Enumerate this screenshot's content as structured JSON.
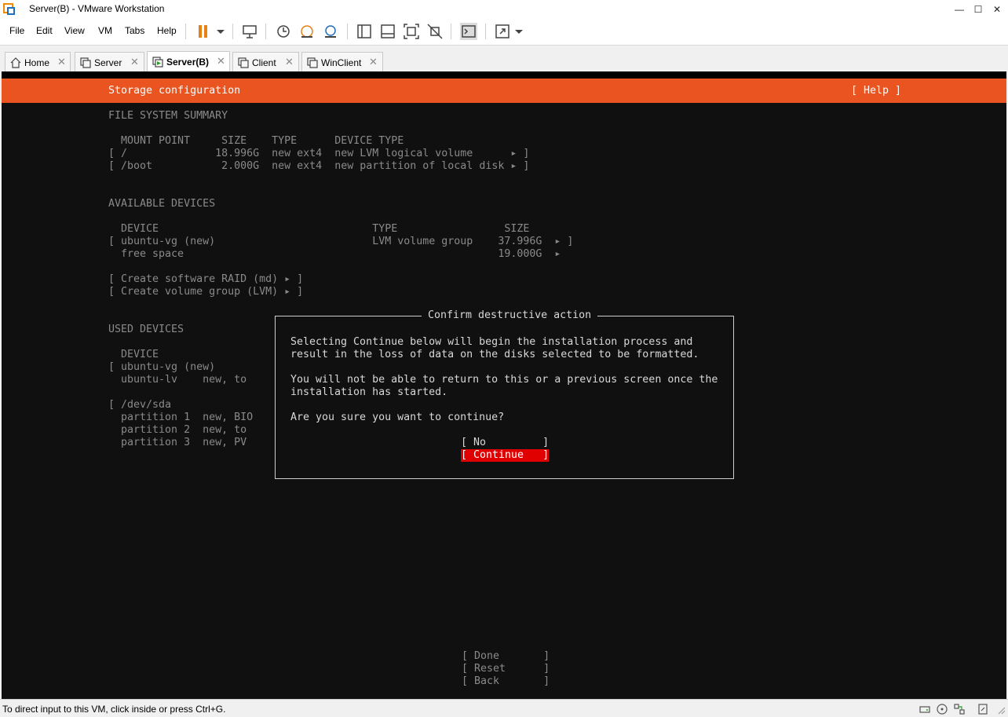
{
  "window": {
    "title": "Server(B) - VMware Workstation",
    "minimize": "—",
    "maximize": "☐",
    "close": "✕"
  },
  "menu": [
    "File",
    "Edit",
    "View",
    "VM",
    "Tabs",
    "Help"
  ],
  "tabs": [
    {
      "label": "Home",
      "close": "✕"
    },
    {
      "label": "Server",
      "close": "✕"
    },
    {
      "label": "Server(B)",
      "close": "✕"
    },
    {
      "label": "Client",
      "close": "✕"
    },
    {
      "label": "WinClient",
      "close": "✕"
    }
  ],
  "installer": {
    "header_title": "Storage configuration",
    "help": "[ Help ]",
    "fs_summary_heading": "FILE SYSTEM SUMMARY",
    "fs_summary_columns": "  MOUNT POINT     SIZE    TYPE      DEVICE TYPE",
    "fs_summary_rows": [
      "[ /              18.996G  new ext4  new LVM logical volume      ▸ ]",
      "[ /boot           2.000G  new ext4  new partition of local disk ▸ ]"
    ],
    "available_heading": "AVAILABLE DEVICES",
    "available_columns": "  DEVICE                                  TYPE                 SIZE",
    "available_rows": [
      "[ ubuntu-vg (new)                         LVM volume group    37.996G  ▸ ]",
      "  free space                                                  19.000G  ▸"
    ],
    "available_actions": [
      "[ Create software RAID (md) ▸ ]",
      "[ Create volume group (LVM) ▸ ]"
    ],
    "used_heading": "USED DEVICES",
    "used_lines": [
      "  DEVICE",
      "[ ubuntu-vg (new)",
      "  ubuntu-lv    new, to",
      "",
      "[ /dev/sda",
      "  partition 1  new, BIO",
      "  partition 2  new, to",
      "  partition 3  new, PV"
    ],
    "bottom_buttons": [
      "[ Done       ]",
      "[ Reset      ]",
      "[ Back       ]"
    ]
  },
  "dialog": {
    "title": "Confirm destructive action",
    "paragraph1": [
      "Selecting Continue below will begin the installation process and",
      "result in the loss of data on the disks selected to be formatted."
    ],
    "paragraph2": [
      "You will not be able to return to this or a previous screen once the",
      "installation has started."
    ],
    "question": "Are you sure you want to continue?",
    "no_button": "[ No         ]",
    "continue_button": "[ Continue   ]"
  },
  "status": {
    "text": "To direct input to this VM, click inside or press Ctrl+G."
  },
  "colors": {
    "ubuntu_orange": "#e95420",
    "selected_button": "#e00000",
    "vm_background": "#101010"
  },
  "icons": [
    "vmware-logo-icon",
    "pause-icon",
    "dropdown-icon",
    "send-keys-icon",
    "snapshot-icon",
    "revert-snapshot-icon",
    "snapshot-manager-icon",
    "library-icon",
    "thumbnail-icon",
    "fullscreen-icon",
    "unity-icon",
    "console-icon",
    "stretch-icon"
  ]
}
